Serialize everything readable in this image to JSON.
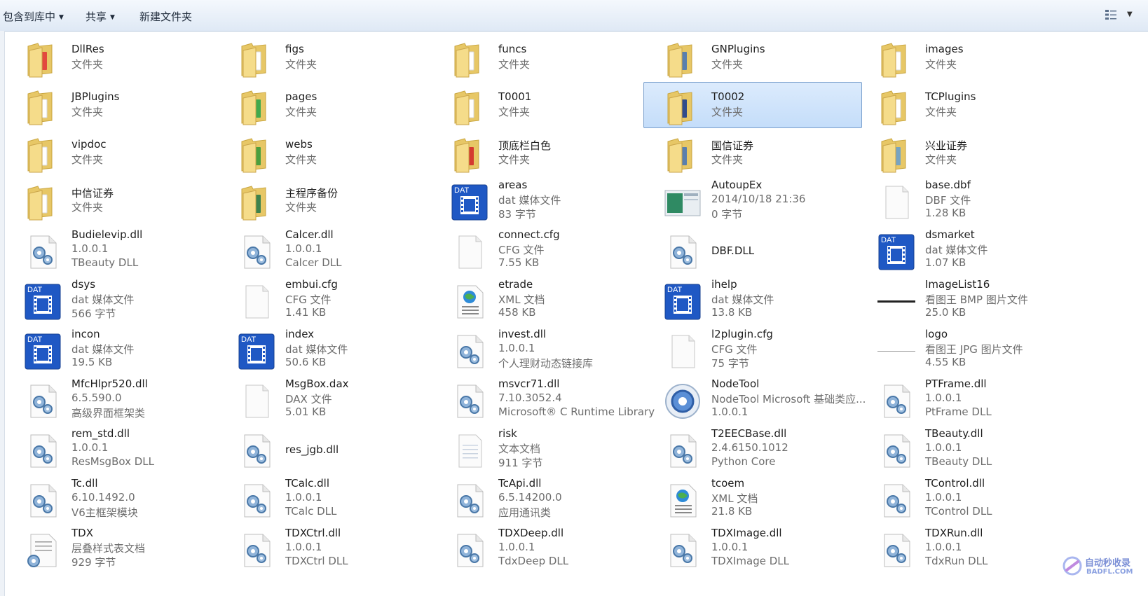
{
  "toolbar": {
    "include_library": "包含到库中",
    "share": "共享",
    "new_folder": "新建文件夹"
  },
  "items": [
    {
      "name": "DllRes",
      "l2": "文件夹",
      "type": "folder",
      "accent": "#e23a3a"
    },
    {
      "name": "figs",
      "l2": "文件夹",
      "type": "folder",
      "accent": ""
    },
    {
      "name": "funcs",
      "l2": "文件夹",
      "type": "folder",
      "accent": ""
    },
    {
      "name": "GNPlugins",
      "l2": "文件夹",
      "type": "folder",
      "accent": "#4a77b5"
    },
    {
      "name": "images",
      "l2": "文件夹",
      "type": "folder",
      "accent": ""
    },
    {
      "name": "JBPlugins",
      "l2": "文件夹",
      "type": "folder",
      "accent": ""
    },
    {
      "name": "pages",
      "l2": "文件夹",
      "type": "folder",
      "accent": "#2fa54a"
    },
    {
      "name": "T0001",
      "l2": "文件夹",
      "type": "folder",
      "accent": ""
    },
    {
      "name": "T0002",
      "l2": "文件夹",
      "type": "folder",
      "accent": "#1d3e8f",
      "selected": true
    },
    {
      "name": "TCPlugins",
      "l2": "文件夹",
      "type": "folder",
      "accent": ""
    },
    {
      "name": "vipdoc",
      "l2": "文件夹",
      "type": "folder",
      "accent": ""
    },
    {
      "name": "webs",
      "l2": "文件夹",
      "type": "folder",
      "accent": "#3a9a3a"
    },
    {
      "name": "顶底栏白色",
      "l2": "文件夹",
      "type": "folder",
      "accent": "#d22a2a"
    },
    {
      "name": "国信证券",
      "l2": "文件夹",
      "type": "folder",
      "accent": "#4a77b5"
    },
    {
      "name": "兴业证券",
      "l2": "文件夹",
      "type": "folder",
      "accent": "#6aa0cc"
    },
    {
      "name": "中信证券",
      "l2": "文件夹",
      "type": "folder",
      "accent": ""
    },
    {
      "name": "主程序备份",
      "l2": "文件夹",
      "type": "folder",
      "accent": "#2a7a4a"
    },
    {
      "name": "areas",
      "l2": "dat 媒体文件",
      "l3": "83 字节",
      "type": "dat"
    },
    {
      "name": "AutoupEx",
      "l2": "2014/10/18 21:36",
      "l3": "0 字节",
      "type": "img"
    },
    {
      "name": "base.dbf",
      "l2": "DBF 文件",
      "l3": "1.28 KB",
      "type": "blank"
    },
    {
      "name": "Budielevip.dll",
      "l2": "1.0.0.1",
      "l3": "TBeauty DLL",
      "type": "dll"
    },
    {
      "name": "Calcer.dll",
      "l2": "1.0.0.1",
      "l3": "Calcer DLL",
      "type": "dll"
    },
    {
      "name": "connect.cfg",
      "l2": "CFG 文件",
      "l3": "7.55 KB",
      "type": "blank"
    },
    {
      "name": "DBF.DLL",
      "type": "dll"
    },
    {
      "name": "dsmarket",
      "l2": "dat 媒体文件",
      "l3": "1.07 KB",
      "type": "dat"
    },
    {
      "name": "dsys",
      "l2": "dat 媒体文件",
      "l3": "566 字节",
      "type": "dat"
    },
    {
      "name": "embui.cfg",
      "l2": "CFG 文件",
      "l3": "1.41 KB",
      "type": "blank"
    },
    {
      "name": "etrade",
      "l2": "XML 文档",
      "l3": "458 KB",
      "type": "xml"
    },
    {
      "name": "ihelp",
      "l2": "dat 媒体文件",
      "l3": "13.8 KB",
      "type": "dat"
    },
    {
      "name": "ImageList16",
      "l2": "看图王 BMP 图片文件",
      "l3": "25.0 KB",
      "type": "line"
    },
    {
      "name": "incon",
      "l2": "dat 媒体文件",
      "l3": "19.5 KB",
      "type": "dat"
    },
    {
      "name": "index",
      "l2": "dat 媒体文件",
      "l3": "50.6 KB",
      "type": "dat"
    },
    {
      "name": "invest.dll",
      "l2": "1.0.0.1",
      "l3": "个人理财动态链接库",
      "type": "dll"
    },
    {
      "name": "l2plugin.cfg",
      "l2": "CFG 文件",
      "l3": "75 字节",
      "type": "blank"
    },
    {
      "name": "logo",
      "l2": "看图王 JPG 图片文件",
      "l3": "4.55 KB",
      "type": "thinline"
    },
    {
      "name": "MfcHlpr520.dll",
      "l2": "6.5.590.0",
      "l3": "高级界面框架类",
      "type": "dll"
    },
    {
      "name": "MsgBox.dax",
      "l2": "DAX 文件",
      "l3": "5.01 KB",
      "type": "blank"
    },
    {
      "name": "msvcr71.dll",
      "l2": "7.10.3052.4",
      "l3": "Microsoft® C Runtime Library",
      "type": "dll"
    },
    {
      "name": "NodeTool",
      "l2": "NodeTool Microsoft 基础类应...",
      "l3": "1.0.0.1",
      "type": "gear"
    },
    {
      "name": "PTFrame.dll",
      "l2": "1.0.0.1",
      "l3": "PtFrame DLL",
      "type": "dll"
    },
    {
      "name": "rem_std.dll",
      "l2": "1.0.0.1",
      "l3": "ResMsgBox DLL",
      "type": "dll"
    },
    {
      "name": "res_jgb.dll",
      "type": "dll"
    },
    {
      "name": "risk",
      "l2": "文本文档",
      "l3": "911 字节",
      "type": "txt"
    },
    {
      "name": "T2EECBase.dll",
      "l2": "2.4.6150.1012",
      "l3": "Python Core",
      "type": "dll"
    },
    {
      "name": "TBeauty.dll",
      "l2": "1.0.0.1",
      "l3": "TBeauty DLL",
      "type": "dll"
    },
    {
      "name": "Tc.dll",
      "l2": "6.10.1492.0",
      "l3": "V6主框架模块",
      "type": "dll"
    },
    {
      "name": "TCalc.dll",
      "l2": "1.0.0.1",
      "l3": "TCalc DLL",
      "type": "dll"
    },
    {
      "name": "TcApi.dll",
      "l2": "6.5.14200.0",
      "l3": "应用通讯类",
      "type": "dll"
    },
    {
      "name": "tcoem",
      "l2": "XML 文档",
      "l3": "21.8 KB",
      "type": "xml"
    },
    {
      "name": "TControl.dll",
      "l2": "1.0.0.1",
      "l3": "TControl DLL",
      "type": "dll"
    },
    {
      "name": "TDX",
      "l2": "层叠样式表文档",
      "l3": "929 字节",
      "type": "css"
    },
    {
      "name": "TDXCtrl.dll",
      "l2": "1.0.0.1",
      "l3": "TDXCtrl DLL",
      "type": "dll"
    },
    {
      "name": "TDXDeep.dll",
      "l2": "1.0.0.1",
      "l3": "TdxDeep DLL",
      "type": "dll"
    },
    {
      "name": "TDXImage.dll",
      "l2": "1.0.0.1",
      "l3": "TDXImage DLL",
      "type": "dll"
    },
    {
      "name": "TDXRun.dll",
      "l2": "1.0.0.1",
      "l3": "TdxRun DLL",
      "type": "dll"
    }
  ],
  "watermark": {
    "line1": "自动秒收录",
    "line2": "BADFL.COM"
  }
}
